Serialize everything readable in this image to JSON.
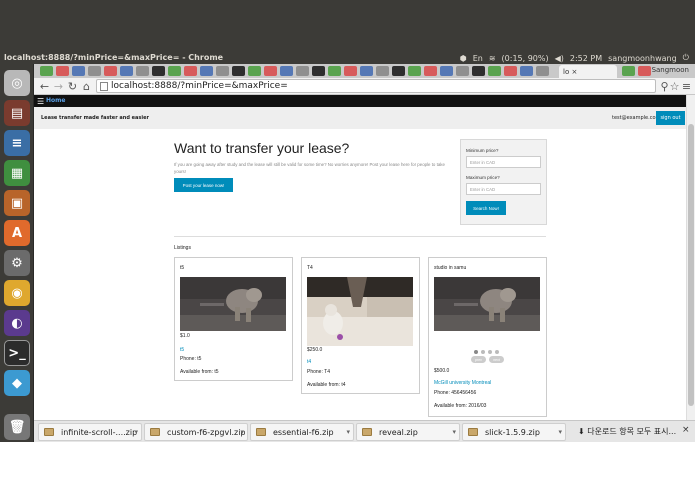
{
  "window": {
    "title": "localhost:8888/?minPrice=&maxPrice= - Chrome"
  },
  "panel": {
    "battery": "(0:15, 90%)",
    "time": "2:52 PM",
    "user": "sangmoonhwang",
    "lang": "En"
  },
  "chrome": {
    "active_tab_label": "lo",
    "tab_user": "Sangmoon",
    "url": "localhost:8888/?minPrice=&maxPrice="
  },
  "site": {
    "nav_menu_icon": "☰",
    "nav_home": "Home",
    "tagline": "Lease transfer made faster and easier",
    "user_email": "test@example.com",
    "signout_label": "sign out",
    "hero_title": "Want to transfer your lease?",
    "hero_text": "If you are going away after study and the lease will still be valid for some time? No worries anymore! Post your lease here for people to take yours!",
    "post_button": "Post your lease now!",
    "filter": {
      "min_label": "Minimum price?",
      "min_placeholder": "Enter in CAD",
      "max_label": "Maximum price?",
      "max_placeholder": "Enter in CAD",
      "search_label": "Search Now!"
    },
    "listings_heading": "Listings"
  },
  "listings": [
    {
      "title": "t5",
      "price": "$1.0",
      "link": "t5",
      "phone": "Phone: t5",
      "available": "Available from: t5"
    },
    {
      "title": "T4",
      "price": "$250.0",
      "link": "t4",
      "phone": "Phone: T4",
      "available": "Available from: t4"
    },
    {
      "title": "studio in samu",
      "price": "$500.0",
      "link": "McGill university Montreal",
      "phone": "Phone: 456456456",
      "available": "Available from: 2016/03",
      "prev_label": "prev",
      "next_label": "next"
    }
  ],
  "downloads": {
    "items": [
      "infinite-scroll-....zip",
      "custom-f6-zpgvl.zip",
      "essential-f6.zip",
      "reveal.zip",
      "slick-1.5.9.zip"
    ],
    "show_all": "다운로드 항목 모두 표시...",
    "close": "×"
  },
  "colors": {
    "accent": "#008cba",
    "panel": "#3c3b37",
    "nav": "#111111"
  }
}
